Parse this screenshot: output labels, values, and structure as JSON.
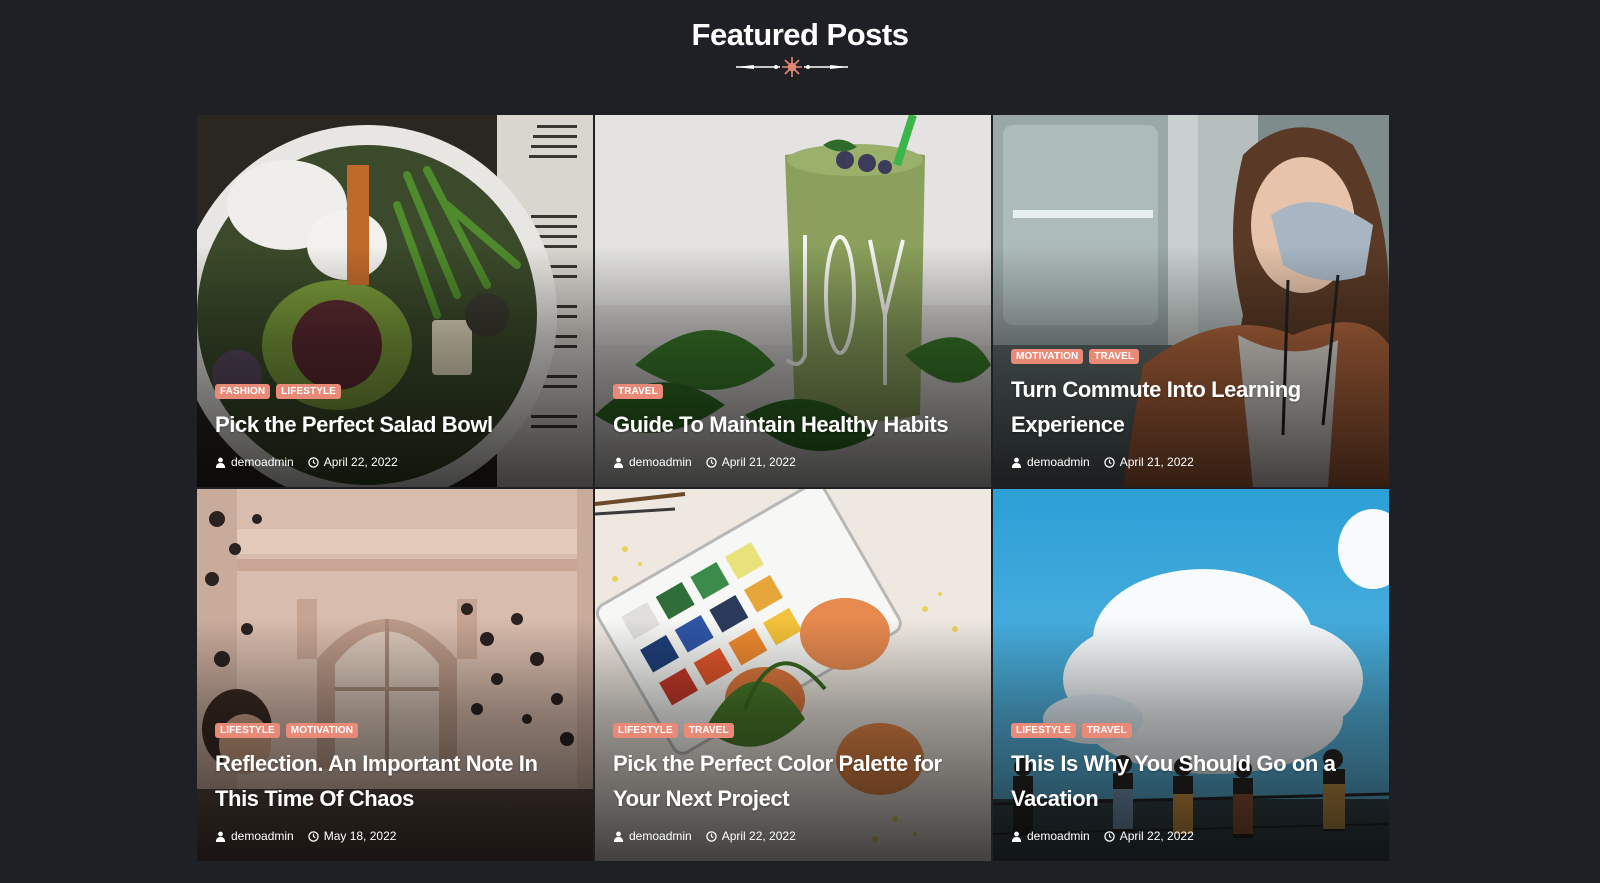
{
  "section": {
    "title": "Featured Posts"
  },
  "colors": {
    "background": "#1f2025",
    "accent": "#e98a78"
  },
  "posts": [
    {
      "image": "salad-bowl-photo",
      "tags": [
        "FASHION",
        "LIFESTYLE"
      ],
      "title": "Pick the Perfect Salad Bowl",
      "author": "demoadmin",
      "date": "April 22, 2022"
    },
    {
      "image": "green-smoothie-joy-glass-photo",
      "tags": [
        "TRAVEL"
      ],
      "title": "Guide To Maintain Healthy Habits",
      "author": "demoadmin",
      "date": "April 21, 2022"
    },
    {
      "image": "woman-with-mask-on-train-photo",
      "tags": [
        "MOTIVATION",
        "TRAVEL"
      ],
      "title": "Turn Commute Into Learning Experience",
      "author": "demoadmin",
      "date": "April 21, 2022"
    },
    {
      "image": "building-facade-plants-photo",
      "tags": [
        "LIFESTYLE",
        "MOTIVATION"
      ],
      "title": "Reflection. An Important Note In This Time Of Chaos",
      "author": "demoadmin",
      "date": "May 18, 2022"
    },
    {
      "image": "watercolor-palette-eggs-photo",
      "tags": [
        "LIFESTYLE",
        "TRAVEL"
      ],
      "title": "Pick the Perfect Color Palette for Your Next Project",
      "author": "demoadmin",
      "date": "April 22, 2022"
    },
    {
      "image": "blue-sky-clouds-people-photo",
      "tags": [
        "LIFESTYLE",
        "TRAVEL"
      ],
      "title": "This Is Why You Should Go on a Vacation",
      "author": "demoadmin",
      "date": "April 22, 2022"
    }
  ]
}
